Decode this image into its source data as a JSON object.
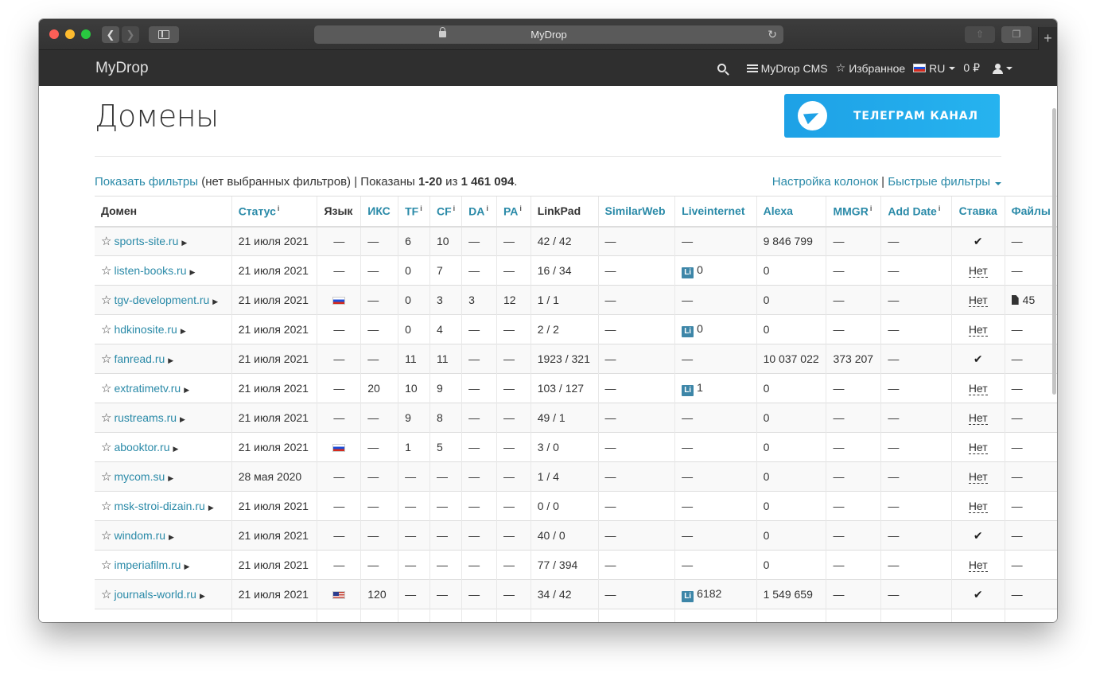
{
  "browser": {
    "url_title": "MyDrop"
  },
  "navbar": {
    "brand": "MyDrop",
    "cms_label": "MyDrop CMS",
    "favorites_label": "Избранное",
    "lang_label": "RU",
    "balance_label": "0 ₽"
  },
  "page": {
    "title": "Домены",
    "telegram_banner": "ТЕЛЕГРАМ КАНАЛ"
  },
  "summary": {
    "show_filters": "Показать фильтры",
    "no_filters": " (нет выбранных фильтров) | Показаны ",
    "range": "1-20",
    "of": " из ",
    "total": "1 461 094",
    "dot": ".",
    "column_settings": "Настройка колонок",
    "separator": " | ",
    "quick_filters": "Быстрые фильтры"
  },
  "table": {
    "columns": [
      {
        "label": "Домен",
        "sortable": false,
        "info": false
      },
      {
        "label": "Статус",
        "sortable": true,
        "info": true
      },
      {
        "label": "Язык",
        "sortable": false,
        "info": false
      },
      {
        "label": "ИКС",
        "sortable": true,
        "info": false
      },
      {
        "label": "TF",
        "sortable": true,
        "info": true
      },
      {
        "label": "CF",
        "sortable": true,
        "info": true
      },
      {
        "label": "DA",
        "sortable": true,
        "info": true
      },
      {
        "label": "PA",
        "sortable": true,
        "info": true
      },
      {
        "label": "LinkPad",
        "sortable": false,
        "info": false
      },
      {
        "label": "SimilarWeb",
        "sortable": true,
        "info": false
      },
      {
        "label": "Liveinternet",
        "sortable": true,
        "info": false
      },
      {
        "label": "Alexa",
        "sortable": true,
        "info": false
      },
      {
        "label": "MMGR",
        "sortable": true,
        "info": true
      },
      {
        "label": "Add Date",
        "sortable": true,
        "info": true
      },
      {
        "label": "Ставка",
        "sortable": true,
        "info": false
      },
      {
        "label": "Файлы",
        "sortable": true,
        "info": false
      }
    ],
    "rows": [
      {
        "domain": "sports-site.ru",
        "status": "21 июля 2021",
        "lang": "",
        "iks": "—",
        "tf": "6",
        "cf": "10",
        "da": "—",
        "pa": "—",
        "linkpad": "42 / 42",
        "similarweb": "—",
        "li": "",
        "alexa": "9 846 799",
        "mmgr": "—",
        "add_date": "—",
        "bid": "check",
        "files": "—"
      },
      {
        "domain": "listen-books.ru",
        "status": "21 июля 2021",
        "lang": "",
        "iks": "—",
        "tf": "0",
        "cf": "7",
        "da": "—",
        "pa": "—",
        "linkpad": "16 / 34",
        "similarweb": "—",
        "li": "0",
        "alexa": "0",
        "mmgr": "—",
        "add_date": "—",
        "bid": "Нет",
        "files": "—"
      },
      {
        "domain": "tgv-development.ru",
        "status": "21 июля 2021",
        "lang": "ru",
        "iks": "—",
        "tf": "0",
        "cf": "3",
        "da": "3",
        "pa": "12",
        "linkpad": "1 / 1",
        "similarweb": "—",
        "li": "",
        "alexa": "0",
        "mmgr": "—",
        "add_date": "—",
        "bid": "Нет",
        "files": "45"
      },
      {
        "domain": "hdkinosite.ru",
        "status": "21 июля 2021",
        "lang": "",
        "iks": "—",
        "tf": "0",
        "cf": "4",
        "da": "—",
        "pa": "—",
        "linkpad": "2 / 2",
        "similarweb": "—",
        "li": "0",
        "alexa": "0",
        "mmgr": "—",
        "add_date": "—",
        "bid": "Нет",
        "files": "—"
      },
      {
        "domain": "fanread.ru",
        "status": "21 июля 2021",
        "lang": "",
        "iks": "—",
        "tf": "11",
        "cf": "11",
        "da": "—",
        "pa": "—",
        "linkpad": "1923 / 321",
        "similarweb": "—",
        "li": "",
        "alexa": "10 037 022",
        "mmgr": "373 207",
        "add_date": "—",
        "bid": "check",
        "files": "—"
      },
      {
        "domain": "extratimetv.ru",
        "status": "21 июля 2021",
        "lang": "",
        "iks": "20",
        "tf": "10",
        "cf": "9",
        "da": "—",
        "pa": "—",
        "linkpad": "103 / 127",
        "similarweb": "—",
        "li": "1",
        "alexa": "0",
        "mmgr": "—",
        "add_date": "—",
        "bid": "Нет",
        "files": "—"
      },
      {
        "domain": "rustreams.ru",
        "status": "21 июля 2021",
        "lang": "",
        "iks": "—",
        "tf": "9",
        "cf": "8",
        "da": "—",
        "pa": "—",
        "linkpad": "49 / 1",
        "similarweb": "—",
        "li": "",
        "alexa": "0",
        "mmgr": "—",
        "add_date": "—",
        "bid": "Нет",
        "files": "—"
      },
      {
        "domain": "abooktor.ru",
        "status": "21 июля 2021",
        "lang": "ru",
        "iks": "—",
        "tf": "1",
        "cf": "5",
        "da": "—",
        "pa": "—",
        "linkpad": "3 / 0",
        "similarweb": "—",
        "li": "",
        "alexa": "0",
        "mmgr": "—",
        "add_date": "—",
        "bid": "Нет",
        "files": "—"
      },
      {
        "domain": "mycom.su",
        "status": "28 мая 2020",
        "lang": "",
        "iks": "—",
        "tf": "—",
        "cf": "—",
        "da": "—",
        "pa": "—",
        "linkpad": "1 / 4",
        "similarweb": "—",
        "li": "",
        "alexa": "0",
        "mmgr": "—",
        "add_date": "—",
        "bid": "Нет",
        "files": "—"
      },
      {
        "domain": "msk-stroi-dizain.ru",
        "status": "21 июля 2021",
        "lang": "",
        "iks": "—",
        "tf": "—",
        "cf": "—",
        "da": "—",
        "pa": "—",
        "linkpad": "0 / 0",
        "similarweb": "—",
        "li": "",
        "alexa": "0",
        "mmgr": "—",
        "add_date": "—",
        "bid": "Нет",
        "files": "—"
      },
      {
        "domain": "windom.ru",
        "status": "21 июля 2021",
        "lang": "",
        "iks": "—",
        "tf": "—",
        "cf": "—",
        "da": "—",
        "pa": "—",
        "linkpad": "40 / 0",
        "similarweb": "—",
        "li": "",
        "alexa": "0",
        "mmgr": "—",
        "add_date": "—",
        "bid": "check",
        "files": "—"
      },
      {
        "domain": "imperiafilm.ru",
        "status": "21 июля 2021",
        "lang": "",
        "iks": "—",
        "tf": "—",
        "cf": "—",
        "da": "—",
        "pa": "—",
        "linkpad": "77 / 394",
        "similarweb": "—",
        "li": "",
        "alexa": "0",
        "mmgr": "—",
        "add_date": "—",
        "bid": "Нет",
        "files": "—"
      },
      {
        "domain": "journals-world.ru",
        "status": "21 июля 2021",
        "lang": "us",
        "iks": "120",
        "tf": "—",
        "cf": "—",
        "da": "—",
        "pa": "—",
        "linkpad": "34 / 42",
        "similarweb": "—",
        "li": "6182",
        "alexa": "1 549 659",
        "mmgr": "—",
        "add_date": "—",
        "bid": "check",
        "files": "—"
      },
      {
        "domain": "",
        "status": "",
        "lang": "",
        "iks": "",
        "tf": "",
        "cf": "",
        "da": "",
        "pa": "",
        "linkpad": "",
        "similarweb": "",
        "li": "",
        "alexa": "",
        "mmgr": "",
        "add_date": "",
        "bid": "",
        "files": ""
      }
    ],
    "empty_mark": "—",
    "li_badge": "Li"
  },
  "colors": {
    "link": "#2a8aa8",
    "navbar_bg": "#2f2f2f",
    "telegram": "#1ea1e6"
  }
}
